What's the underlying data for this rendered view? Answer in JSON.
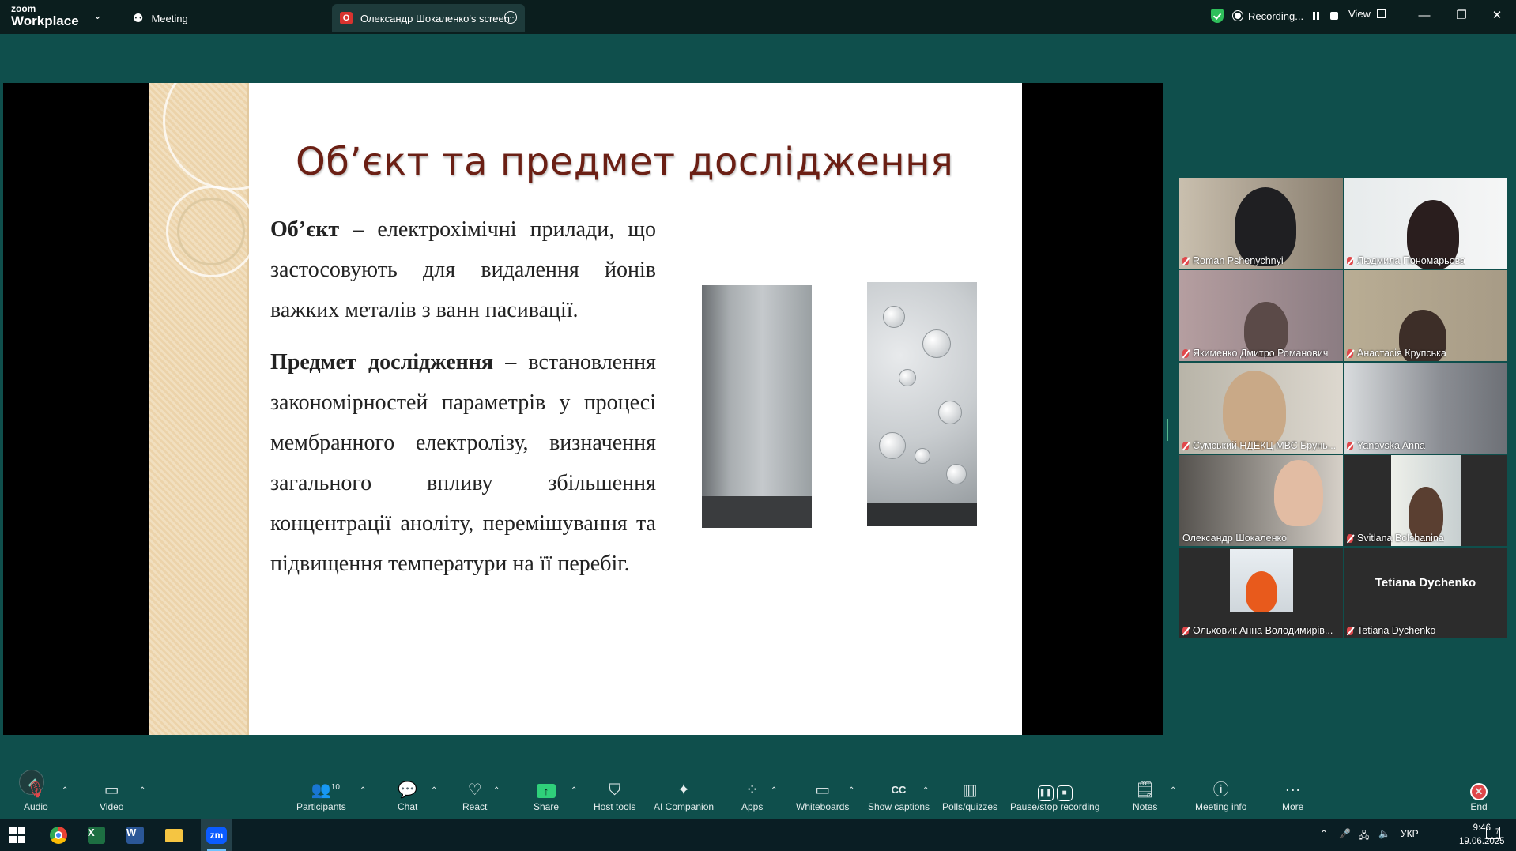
{
  "app": {
    "logo_top": "zoom",
    "logo_bottom": "Workplace"
  },
  "tabs": [
    {
      "label": "Meeting",
      "icon": "meeting-icon"
    },
    {
      "label": "Олександр Шокаленко's screen",
      "avatar_letter": "О"
    }
  ],
  "recording": {
    "label": "Recording...",
    "status_color": "#2fbf5b"
  },
  "view": {
    "label": "View"
  },
  "window_controls": {
    "minimize": "—",
    "restore": "❐",
    "close": "✕"
  },
  "slide": {
    "title": "Об’єкт та предмет дослідження",
    "object_term": "Об’єкт",
    "object_text": " – електрохімічні прилади, що застосовують для видалення йонів важких металів з ванн пасивації.",
    "subject_term": "Предмет дослідження",
    "subject_text": " – встановлення закономірностей параметрів у процесі мембранного електролізу, визначення загального впливу збільшення концентрації аноліту, перемішування та підвищення температури на її перебіг."
  },
  "participants_gallery": [
    {
      "name": "Roman Pshenychnyi",
      "muted": true
    },
    {
      "name": "Людмила Пономарьова",
      "muted": true
    },
    {
      "name": "Якименко Дмитро Романович",
      "muted": true
    },
    {
      "name": "Анастасія Крупська",
      "muted": true
    },
    {
      "name": "Сумський НДЕКЦ МВС Брунь...",
      "muted": true
    },
    {
      "name": "Yanovska Anna",
      "muted": true
    },
    {
      "name": "Олександр Шокаленко",
      "muted": false,
      "active_speaker": true
    },
    {
      "name": "Svitlana Bolshanina",
      "muted": true
    },
    {
      "name": "Ольховик Анна Володимирів...",
      "muted": true
    },
    {
      "name": "Tetiana Dychenko",
      "muted": true,
      "video_off_label": "Tetiana Dychenko"
    }
  ],
  "toolbar": {
    "audio": "Audio",
    "video": "Video",
    "participants": "Participants",
    "participants_count": "10",
    "chat": "Chat",
    "react": "React",
    "share": "Share",
    "host_tools": "Host tools",
    "ai_companion": "AI Companion",
    "apps": "Apps",
    "whiteboards": "Whiteboards",
    "show_captions": "Show captions",
    "polls": "Polls/quizzes",
    "pause_stop_recording": "Pause/stop recording",
    "notes": "Notes",
    "meeting_info": "Meeting info",
    "more": "More",
    "end": "End",
    "accent_color": "#2fd07a",
    "end_color": "#e0484b"
  },
  "taskbar": {
    "language": "УКР",
    "time": "9:46",
    "date": "19.06.2025",
    "notifications": "7"
  }
}
